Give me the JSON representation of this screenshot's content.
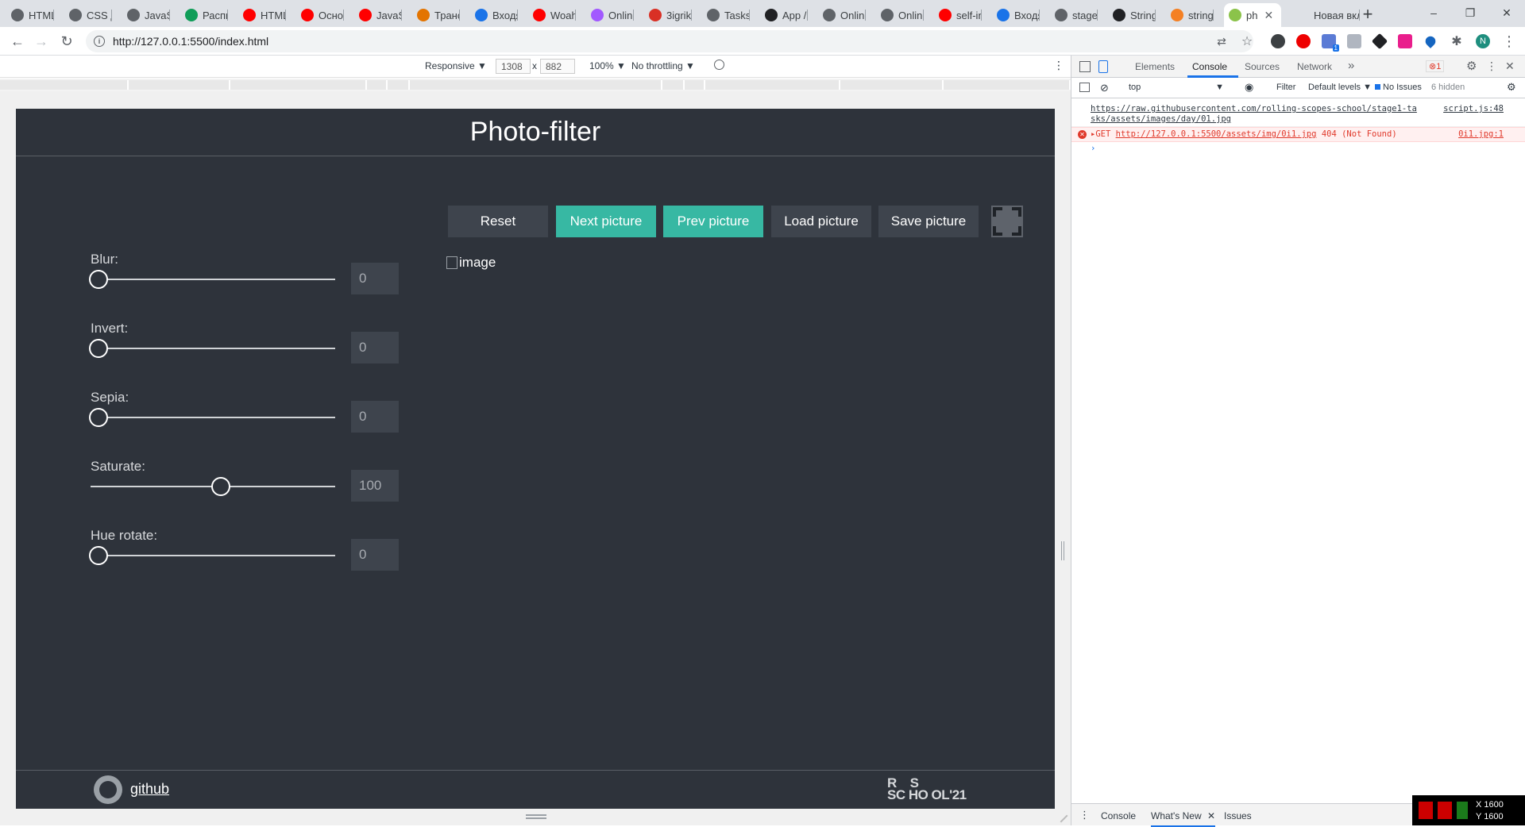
{
  "browser": {
    "tabs": [
      {
        "label": "HTML",
        "color": "#5f6368"
      },
      {
        "label": "CSS д",
        "color": "#5f6368"
      },
      {
        "label": "JavaSc",
        "color": "#5f6368"
      },
      {
        "label": "Распи",
        "color": "#0f9d58"
      },
      {
        "label": "HTML",
        "color": "#ff0000"
      },
      {
        "label": "Основ",
        "color": "#ff0000"
      },
      {
        "label": "JavaSc",
        "color": "#ff0000"
      },
      {
        "label": "Транс",
        "color": "#e37400"
      },
      {
        "label": "Входя",
        "color": "#1a73e8"
      },
      {
        "label": "Woah",
        "color": "#ff0000"
      },
      {
        "label": "Online",
        "color": "#a259ff"
      },
      {
        "label": "3igrik",
        "color": "#d93025"
      },
      {
        "label": "Tasks",
        "color": "#5f6368"
      },
      {
        "label": "App /",
        "color": "#202124"
      },
      {
        "label": "Online",
        "color": "#5f6368"
      },
      {
        "label": "Online",
        "color": "#5f6368"
      },
      {
        "label": "self-in",
        "color": "#ff0000"
      },
      {
        "label": "Входя",
        "color": "#1a73e8"
      },
      {
        "label": "stage1",
        "color": "#5f6368"
      },
      {
        "label": "String",
        "color": "#202124"
      },
      {
        "label": "string",
        "color": "#f48024"
      },
      {
        "label": "ph",
        "color": "#8bc34a",
        "active": true
      },
      {
        "label": "Новая вкл",
        "color": "#dee1e6"
      }
    ],
    "window_controls": [
      "–",
      "❐",
      "✕"
    ],
    "url": "http://127.0.0.1:5500/index.html",
    "profile_initial": "N",
    "ext_badge": "1"
  },
  "device_toolbar": {
    "mode": "Responsive ▼",
    "width": "1308",
    "times": "x",
    "height": "882",
    "zoom": "100% ▼",
    "throttling": "No throttling ▼"
  },
  "app": {
    "title": "Photo-filter",
    "filters": [
      {
        "label": "Blur:",
        "value": "0",
        "fraction": 0
      },
      {
        "label": "Invert:",
        "value": "0",
        "fraction": 0
      },
      {
        "label": "Sepia:",
        "value": "0",
        "fraction": 0
      },
      {
        "label": "Saturate:",
        "value": "100",
        "fraction": 0.5
      },
      {
        "label": "Hue rotate:",
        "value": "0",
        "fraction": 0
      }
    ],
    "buttons": {
      "reset": "Reset",
      "next": "Next picture",
      "prev": "Prev picture",
      "load": "Load picture",
      "save": "Save picture"
    },
    "image_alt": "image",
    "footer": {
      "github": "github",
      "logo_line1": "R    S ",
      "logo_line2": "SC HO OL'21"
    }
  },
  "devtools": {
    "tabs": [
      "Elements",
      "Console",
      "Sources",
      "Network"
    ],
    "active_tab": "Console",
    "more": "»",
    "error_badge": "1",
    "context": "top",
    "filter_label": "Filter",
    "levels": "Default levels ▼",
    "issues": "No Issues",
    "hidden": "6 hidden",
    "log_url_1": "https://raw.githubusercontent.com/rolling-scopes-school/stage1-ta",
    "log_url_2": "sks/assets/images/day/01.jpg",
    "log_src": "script.js:48",
    "err_method": "▸GET",
    "err_url": "http://127.0.0.1:5500/assets/img/0i1.jpg",
    "err_status": "404 (Not Found)",
    "err_src": "0i1.jpg:1",
    "prompt": "›",
    "drawer": [
      "Console",
      "What's New",
      "Issues"
    ]
  },
  "overlay": {
    "x": "X 1600",
    "y": "Y 1600"
  }
}
